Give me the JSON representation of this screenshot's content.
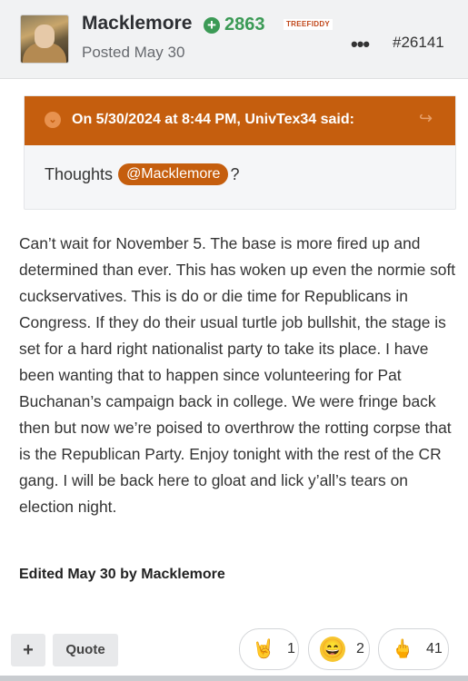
{
  "header": {
    "username": "Macklemore",
    "rep_icon": "plus-circle-icon",
    "reputation": "2863",
    "badge": "TREEFIDDY",
    "posted": "Posted May 30",
    "more_icon": "•••",
    "post_number": "#26141"
  },
  "quote": {
    "title": "On 5/30/2024 at 8:44 PM, UnivTex34 said:",
    "chevron": "⌄",
    "share_icon": "↪",
    "text": "Thoughts",
    "mention": "@Macklemore",
    "tail": "?"
  },
  "post": {
    "body": "Can’t wait for November 5. The base is more fired up and determined than ever. This has woken up even the normie soft cuckservatives. This is do or die time for Republicans in Congress. If they do their usual turtle job bullshit, the stage is set for a hard right nationalist party to take its place. I have been wanting that to happen since volunteering for Pat Buchanan’s campaign back in college. We were fringe back then but now we’re poised to overthrow the rotting corpse that is the Republican Party. Enjoy tonight with the rest of the CR gang. I will be back here to gloat and lick y’all’s tears on election night.",
    "edited": "Edited May 30 by Macklemore"
  },
  "actions": {
    "plus": "+",
    "quote": "Quote"
  },
  "reactions": [
    {
      "icon": "rock-on-hand-icon",
      "glyph": "🤘",
      "count": "1"
    },
    {
      "icon": "laughing-face-icon",
      "glyph": "😄",
      "count": "2"
    },
    {
      "icon": "middle-finger-icon",
      "glyph": "🖕",
      "count": "41"
    }
  ],
  "colors": {
    "accent": "#c55e0e",
    "reputation_green": "#3b9a55"
  }
}
